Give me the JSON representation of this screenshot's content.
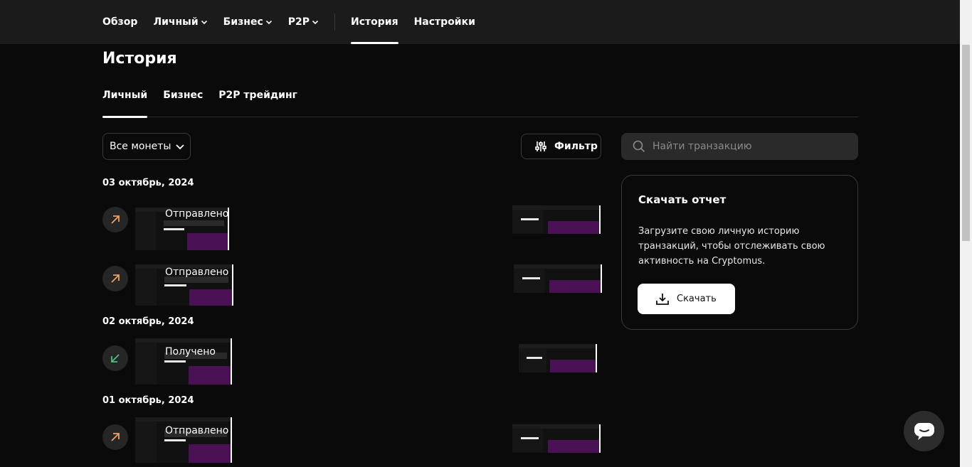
{
  "nav": {
    "items": [
      {
        "label": "Обзор"
      },
      {
        "label": "Личный"
      },
      {
        "label": "Бизнес"
      },
      {
        "label": "P2P"
      },
      {
        "label": "История"
      },
      {
        "label": "Настройки"
      }
    ],
    "active": "История"
  },
  "page": {
    "title": "История"
  },
  "tabs": [
    {
      "label": "Личный"
    },
    {
      "label": "Бизнес"
    },
    {
      "label": "P2P трейдинг"
    }
  ],
  "active_tab": "Личный",
  "filters": {
    "coins_label": "Все монеты",
    "filter_label": "Фильтр",
    "search_placeholder": "Найти транзакцию"
  },
  "groups": [
    {
      "date": "03 октябрь, 2024",
      "transactions": [
        {
          "label": "Отправлено",
          "direction": "sent"
        },
        {
          "label": "Отправлено",
          "direction": "sent"
        }
      ]
    },
    {
      "date": "02 октябрь, 2024",
      "transactions": [
        {
          "label": "Получено",
          "direction": "received"
        }
      ]
    },
    {
      "date": "01 октябрь, 2024",
      "transactions": [
        {
          "label": "Отправлено",
          "direction": "sent"
        }
      ]
    }
  ],
  "report": {
    "title": "Скачать отчет",
    "description": "Загрузите свою личную историю транзакций, чтобы отслеживать свою активность на Cryptomus.",
    "button_label": "Скачать"
  },
  "colors": {
    "background": "#0a0a0a",
    "topbar": "#1b1b1b",
    "sent_arrow": "#f0a060",
    "received_arrow": "#4cc080",
    "accent_purple": "#4a1254"
  },
  "icons": {
    "sent": "arrow-up-right-icon",
    "received": "arrow-down-left-icon",
    "search": "search-icon",
    "filter": "sliders-icon",
    "download": "download-icon",
    "chat": "chat-icon"
  }
}
